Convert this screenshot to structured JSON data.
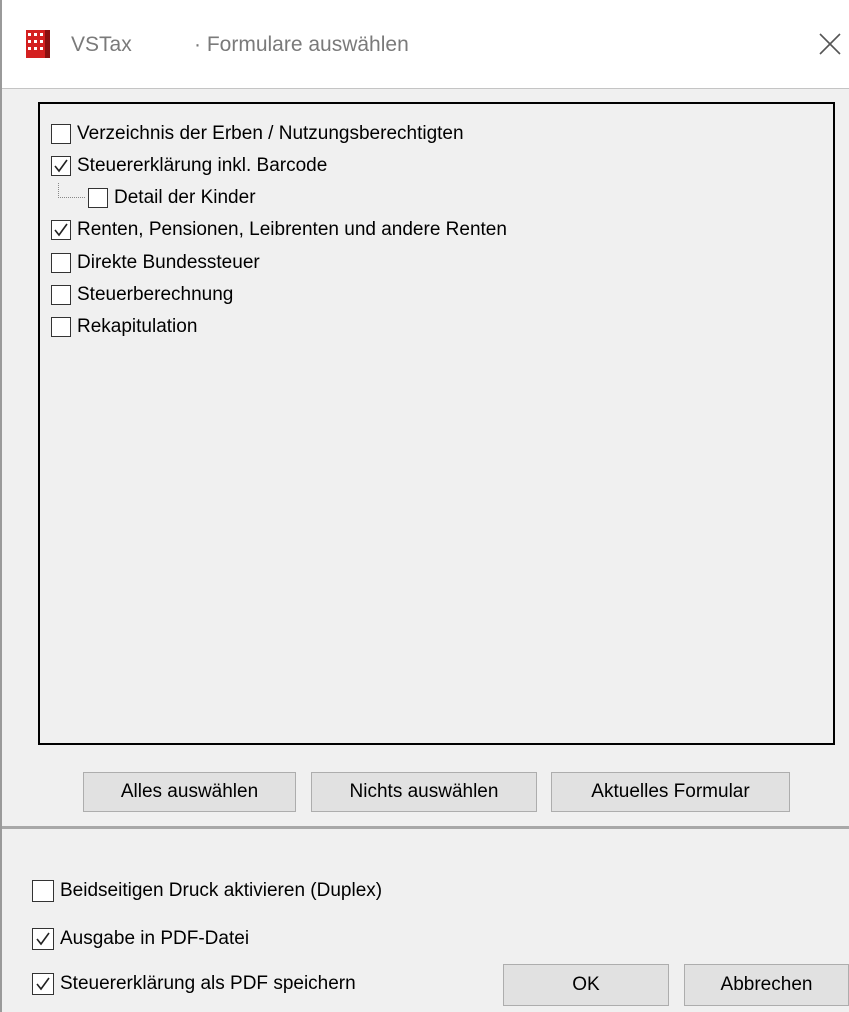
{
  "window": {
    "app_name": "VSTax",
    "title": "· Formulare auswählen",
    "app_icon": "vstax-logo-icon",
    "close_icon": "close-icon"
  },
  "forms": [
    {
      "label": "Verzeichnis der Erben / Nutzungsberechtigten",
      "checked": false,
      "level": 0
    },
    {
      "label": "Steuererklärung inkl. Barcode",
      "checked": true,
      "level": 0
    },
    {
      "label": "Detail der Kinder",
      "checked": false,
      "level": 1
    },
    {
      "label": "Renten, Pensionen, Leibrenten und andere Renten",
      "checked": true,
      "level": 0
    },
    {
      "label": "Direkte Bundessteuer",
      "checked": false,
      "level": 0
    },
    {
      "label": "Steuerberechnung",
      "checked": false,
      "level": 0
    },
    {
      "label": "Rekapitulation",
      "checked": false,
      "level": 0
    }
  ],
  "buttons": {
    "select_all": "Alles auswählen",
    "select_none": "Nichts auswählen",
    "current_form": "Aktuelles Formular",
    "ok": "OK",
    "cancel": "Abbrechen"
  },
  "options": [
    {
      "label": "Beidseitigen Druck aktivieren (Duplex)",
      "checked": false
    },
    {
      "label": "Ausgabe in PDF-Datei",
      "checked": true
    },
    {
      "label": "Steuererklärung als PDF speichern",
      "checked": true
    }
  ],
  "colors": {
    "background": "#f0f0f0",
    "titlebar": "#ffffff",
    "title_text": "#7a7a7a",
    "button_face": "#e1e1e1",
    "logo_red": "#d42020"
  }
}
